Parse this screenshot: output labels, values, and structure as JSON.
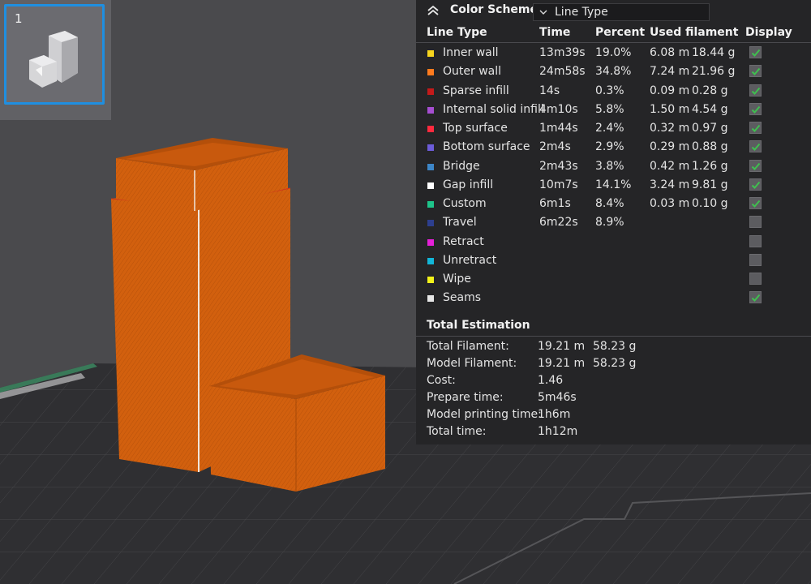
{
  "plate": {
    "number": "1"
  },
  "panel": {
    "header_label": "Color Scheme",
    "scheme_value": "Line Type",
    "columns": {
      "line_type": "Line Type",
      "time": "Time",
      "percent": "Percent",
      "used_filament": "Used filament",
      "display": "Display"
    },
    "rows": [
      {
        "name": "Inner wall",
        "color": "#f7d51e",
        "time": "13m39s",
        "percent": "19.0%",
        "length": "6.08 m",
        "weight": "18.44 g",
        "display": true
      },
      {
        "name": "Outer wall",
        "color": "#ff7b1e",
        "time": "24m58s",
        "percent": "34.8%",
        "length": "7.24 m",
        "weight": "21.96 g",
        "display": true
      },
      {
        "name": "Sparse infill",
        "color": "#c41a1a",
        "time": "14s",
        "percent": "0.3%",
        "length": "0.09 m",
        "weight": "0.28 g",
        "display": true
      },
      {
        "name": "Internal solid infill",
        "color": "#a64ed1",
        "time": "4m10s",
        "percent": "5.8%",
        "length": "1.50 m",
        "weight": "4.54 g",
        "display": true
      },
      {
        "name": "Top surface",
        "color": "#ff2a3e",
        "time": "1m44s",
        "percent": "2.4%",
        "length": "0.32 m",
        "weight": "0.97 g",
        "display": true
      },
      {
        "name": "Bottom surface",
        "color": "#6c5cd9",
        "time": "2m4s",
        "percent": "2.9%",
        "length": "0.29 m",
        "weight": "0.88 g",
        "display": true
      },
      {
        "name": "Bridge",
        "color": "#3d86c8",
        "time": "2m43s",
        "percent": "3.8%",
        "length": "0.42 m",
        "weight": "1.26 g",
        "display": true
      },
      {
        "name": "Gap infill",
        "color": "#ffffff",
        "time": "10m7s",
        "percent": "14.1%",
        "length": "3.24 m",
        "weight": "9.81 g",
        "display": true
      },
      {
        "name": "Custom",
        "color": "#1ec48a",
        "time": "6m1s",
        "percent": "8.4%",
        "length": "0.03 m",
        "weight": "0.10 g",
        "display": true
      },
      {
        "name": "Travel",
        "color": "#2d3f8f",
        "time": "6m22s",
        "percent": "8.9%",
        "length": "",
        "weight": "",
        "display": false
      },
      {
        "name": "Retract",
        "color": "#e520d8",
        "time": "",
        "percent": "",
        "length": "",
        "weight": "",
        "display": false
      },
      {
        "name": "Unretract",
        "color": "#12b6d8",
        "time": "",
        "percent": "",
        "length": "",
        "weight": "",
        "display": false
      },
      {
        "name": "Wipe",
        "color": "#f2f21a",
        "time": "",
        "percent": "",
        "length": "",
        "weight": "",
        "display": false
      },
      {
        "name": "Seams",
        "color": "#e6e6e6",
        "time": "",
        "percent": "",
        "length": "",
        "weight": "",
        "display": true
      }
    ],
    "total_title": "Total Estimation",
    "totals": [
      {
        "label": "Total Filament:",
        "value": "19.21 m",
        "value2": "58.23 g"
      },
      {
        "label": "Model Filament:",
        "value": "19.21 m",
        "value2": "58.23 g"
      },
      {
        "label": "Cost:",
        "value": "1.46",
        "value2": ""
      },
      {
        "label": "Prepare time:",
        "value": "5m46s",
        "value2": ""
      },
      {
        "label": "Model printing time:",
        "value": "1h6m",
        "value2": ""
      },
      {
        "label": "Total time:",
        "value": "1h12m",
        "value2": ""
      }
    ]
  },
  "colors": {
    "accent_blue": "#1f8fe0",
    "check_green": "#3fbf4f",
    "print_orange": "#d2600e"
  }
}
